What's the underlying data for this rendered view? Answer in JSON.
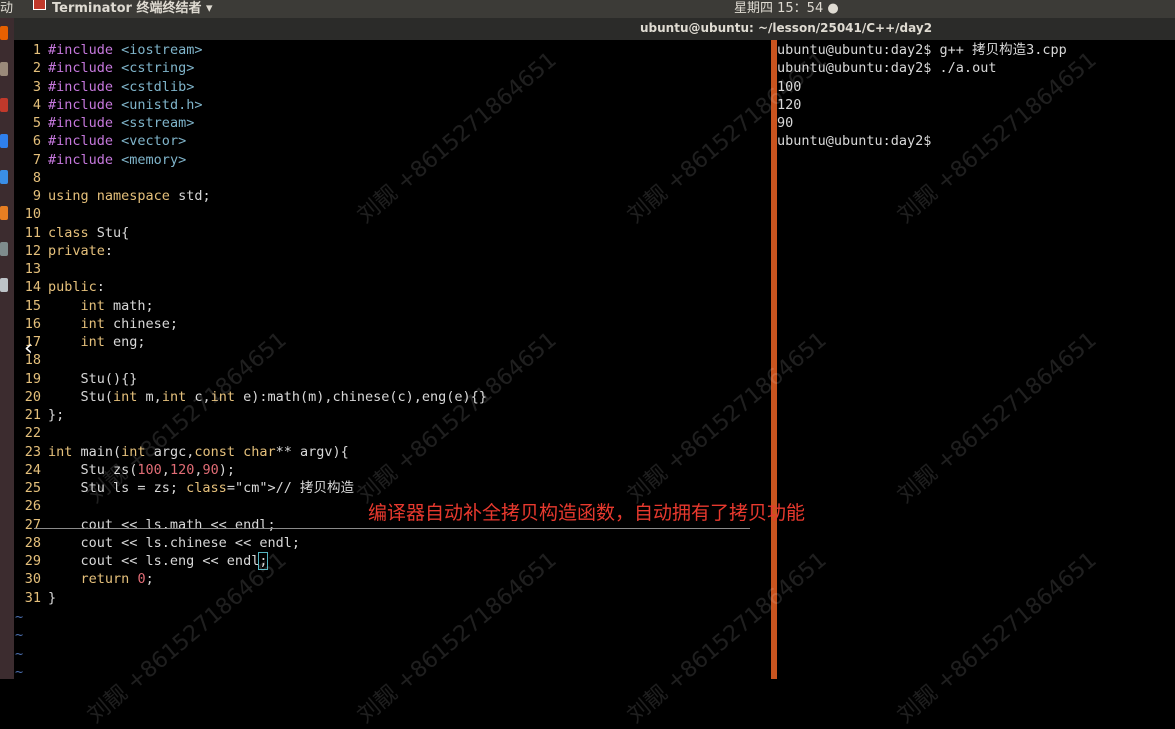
{
  "topbar": {
    "activities": "动",
    "app_name": "Terminator 终端终结者 ▾",
    "clock": "星期四 15：54 ●"
  },
  "window": {
    "title": "ubuntu@ubuntu: ~/lesson/25041/C++/day2"
  },
  "code": [
    {
      "n": "1",
      "t": "#include <iostream>"
    },
    {
      "n": "2",
      "t": "#include <cstring>"
    },
    {
      "n": "3",
      "t": "#include <cstdlib>"
    },
    {
      "n": "4",
      "t": "#include <unistd.h>"
    },
    {
      "n": "5",
      "t": "#include <sstream>"
    },
    {
      "n": "6",
      "t": "#include <vector>"
    },
    {
      "n": "7",
      "t": "#include <memory>"
    },
    {
      "n": "8",
      "t": ""
    },
    {
      "n": "9",
      "t": "using namespace std;"
    },
    {
      "n": "10",
      "t": ""
    },
    {
      "n": "11",
      "t": "class Stu{"
    },
    {
      "n": "12",
      "t": "private:"
    },
    {
      "n": "13",
      "t": ""
    },
    {
      "n": "14",
      "t": "public:"
    },
    {
      "n": "15",
      "t": "    int math;"
    },
    {
      "n": "16",
      "t": "    int chinese;"
    },
    {
      "n": "17",
      "t": "    int eng;"
    },
    {
      "n": "18",
      "t": ""
    },
    {
      "n": "19",
      "t": "    Stu(){}"
    },
    {
      "n": "20",
      "t": "    Stu(int m,int c,int e):math(m),chinese(c),eng(e){}"
    },
    {
      "n": "21",
      "t": "};"
    },
    {
      "n": "22",
      "t": ""
    },
    {
      "n": "23",
      "t": "int main(int argc,const char** argv){"
    },
    {
      "n": "24",
      "t": "    Stu zs(100,120,90);"
    },
    {
      "n": "25",
      "t": "    Stu ls = zs; // 拷贝构造"
    },
    {
      "n": "26",
      "t": ""
    },
    {
      "n": "27",
      "t": "    cout << ls.math << endl;"
    },
    {
      "n": "28",
      "t": "    cout << ls.chinese << endl;"
    },
    {
      "n": "29",
      "t": "    cout << ls.eng << endl;"
    },
    {
      "n": "30",
      "t": "    return 0;"
    },
    {
      "n": "31",
      "t": "}"
    }
  ],
  "tildes": [
    "~",
    "~",
    "~",
    "~"
  ],
  "annotation": "编译器自动补全拷贝构造函数，自动拥有了拷贝功能",
  "terminal": [
    "ubuntu@ubuntu:day2$ g++ 拷贝构造3.cpp",
    "ubuntu@ubuntu:day2$ ./a.out",
    "100",
    "120",
    "90",
    "ubuntu@ubuntu:day2$"
  ],
  "watermark": "刘靓 +8615271864651",
  "colors": {
    "divider": "#c9541f",
    "annotation": "#e8392e",
    "line_number": "#e5c07b"
  }
}
